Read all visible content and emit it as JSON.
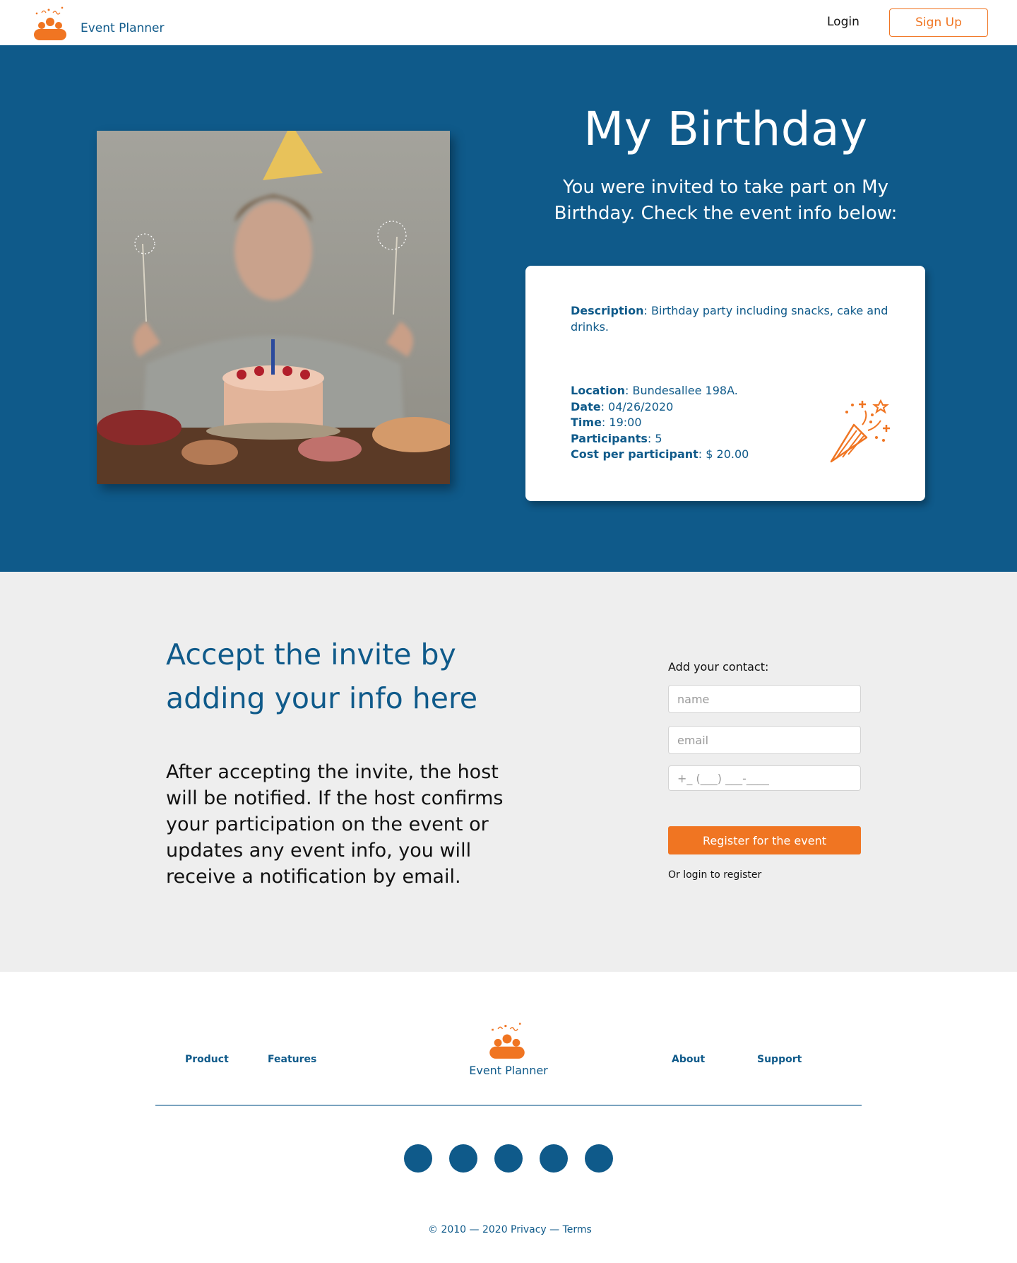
{
  "brand": {
    "name": "Event Planner",
    "primary_color": "#0f5a8a",
    "accent_color": "#f07522",
    "logo_icon": "people-party-icon"
  },
  "nav": {
    "login_label": "Login",
    "signup_label": "Sign Up"
  },
  "hero": {
    "title": "My Birthday",
    "subtitle": "You were invited to take part on My Birthday. Check the event info below:",
    "image": "birthday-photo"
  },
  "event": {
    "description_label": "Description",
    "description_value": ": Birthday party including snacks, cake and drinks.",
    "location_label": "Location",
    "location_value": ": Bundesallee 198A.",
    "date_label": "Date",
    "date_value": ": 04/26/2020",
    "time_label": "Time",
    "time_value": ": 19:00",
    "participants_label": "Participants",
    "participants_value": ": 5",
    "cost_label": "Cost per participant",
    "cost_value": ": $ 20.00",
    "icon": "party-popper-icon"
  },
  "invite": {
    "title": "Accept the invite by adding your info here",
    "body": "After accepting the invite, the host will be notified. If the host confirms your participation on the event or updates any event info, you will receive a notification by email.",
    "contact_label": "Add your contact:",
    "name_placeholder": "name",
    "email_placeholder": "email",
    "phone_placeholder": "+_ (___) ___-____",
    "register_label": "Register for the event",
    "or_login_label": "Or login to register"
  },
  "footer": {
    "links_left": [
      "Product",
      "Features"
    ],
    "links_right": [
      "About",
      "Support"
    ],
    "brand_name": "Event Planner",
    "copyright": "© 2010 — 2020",
    "legal": "Privacy — Terms",
    "social_count_icons": [
      "social-icon-1",
      "social-icon-2",
      "social-icon-3",
      "social-icon-4",
      "social-icon-5"
    ]
  }
}
